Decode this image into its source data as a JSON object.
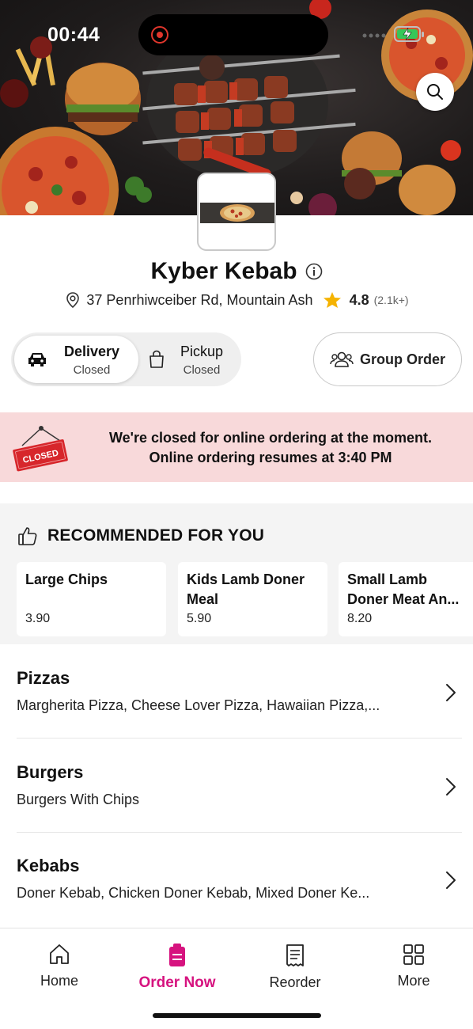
{
  "status_bar": {
    "time": "00:44"
  },
  "restaurant": {
    "name": "Kyber Kebab",
    "address": "37 Penrhiwceiber Rd, Mountain Ash",
    "rating": "4.8",
    "rating_count": "(2.1k+)"
  },
  "mode_toggle": {
    "delivery": {
      "label": "Delivery",
      "status": "Closed"
    },
    "pickup": {
      "label": "Pickup",
      "status": "Closed"
    },
    "selected": "Delivery"
  },
  "group_order": {
    "label": "Group Order"
  },
  "closed_banner": {
    "sign_text": "CLOSED",
    "line1": "We're closed for online ordering at the moment.",
    "line2": "Online ordering resumes at 3:40 PM"
  },
  "recommended": {
    "title": "RECOMMENDED FOR YOU",
    "items": [
      {
        "name": "Large Chips",
        "price": "3.90"
      },
      {
        "name": "Kids Lamb Doner Meal",
        "price": "5.90"
      },
      {
        "name": "Small Lamb Doner Meat An...",
        "price": "8.20"
      }
    ]
  },
  "categories": [
    {
      "title": "Pizzas",
      "items": "Margherita Pizza, Cheese Lover Pizza, Hawaiian Pizza,..."
    },
    {
      "title": "Burgers",
      "items": "Burgers With Chips"
    },
    {
      "title": "Kebabs",
      "items": "Doner Kebab, Chicken Doner Kebab, Mixed Doner Ke..."
    }
  ],
  "bottom_nav": {
    "items": [
      {
        "label": "Home",
        "icon": "home-icon"
      },
      {
        "label": "Order Now",
        "icon": "order-icon"
      },
      {
        "label": "Reorder",
        "icon": "receipt-icon"
      },
      {
        "label": "More",
        "icon": "grid-icon"
      }
    ],
    "active": "Order Now"
  },
  "colors": {
    "accent": "#d6137f",
    "banner_bg": "#f8d9da",
    "star": "#f5b301",
    "closed_sign": "#d7262b"
  }
}
